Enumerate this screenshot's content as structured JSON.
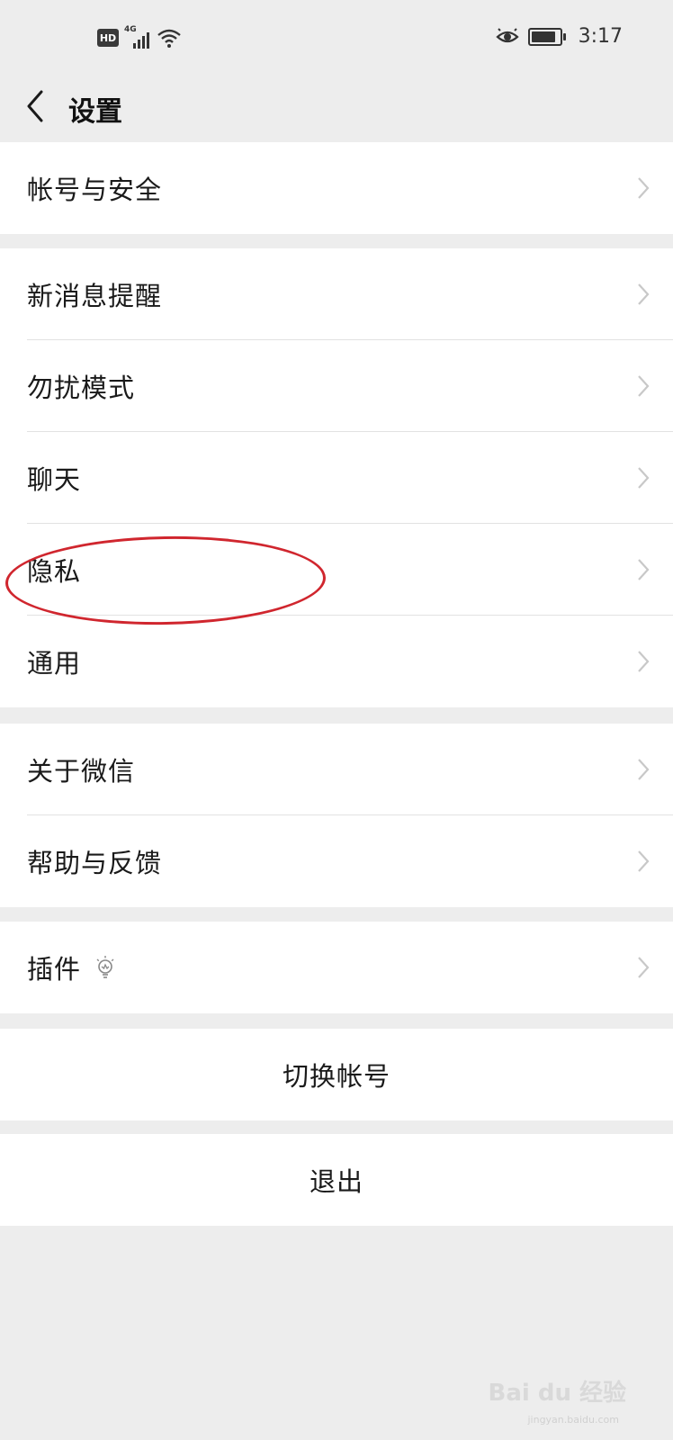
{
  "status_bar": {
    "hd_label": "HD",
    "network_label": "4G",
    "time": "3:17",
    "icons": [
      "signal-icon",
      "wifi-icon",
      "eye-icon",
      "battery-icon"
    ]
  },
  "header": {
    "back_icon": "chevron-left-icon",
    "title": "设置"
  },
  "groups": [
    {
      "items": [
        {
          "label": "帐号与安全"
        }
      ]
    },
    {
      "items": [
        {
          "label": "新消息提醒"
        },
        {
          "label": "勿扰模式"
        },
        {
          "label": "聊天"
        },
        {
          "label": "隐私"
        },
        {
          "label": "通用"
        }
      ]
    },
    {
      "items": [
        {
          "label": "关于微信"
        },
        {
          "label": "帮助与反馈"
        }
      ]
    },
    {
      "items": [
        {
          "label": "插件",
          "icon": "lightbulb-icon"
        }
      ]
    }
  ],
  "actions": {
    "switch_account": "切换帐号",
    "logout": "退出"
  },
  "annotation": {
    "highlight_color": "#d0262e"
  },
  "watermark": {
    "text": "Bai du 经验",
    "sub": "jingyan.baidu.com"
  },
  "colors": {
    "background": "#ededed",
    "card": "#ffffff",
    "chevron": "#c8c8c8"
  }
}
